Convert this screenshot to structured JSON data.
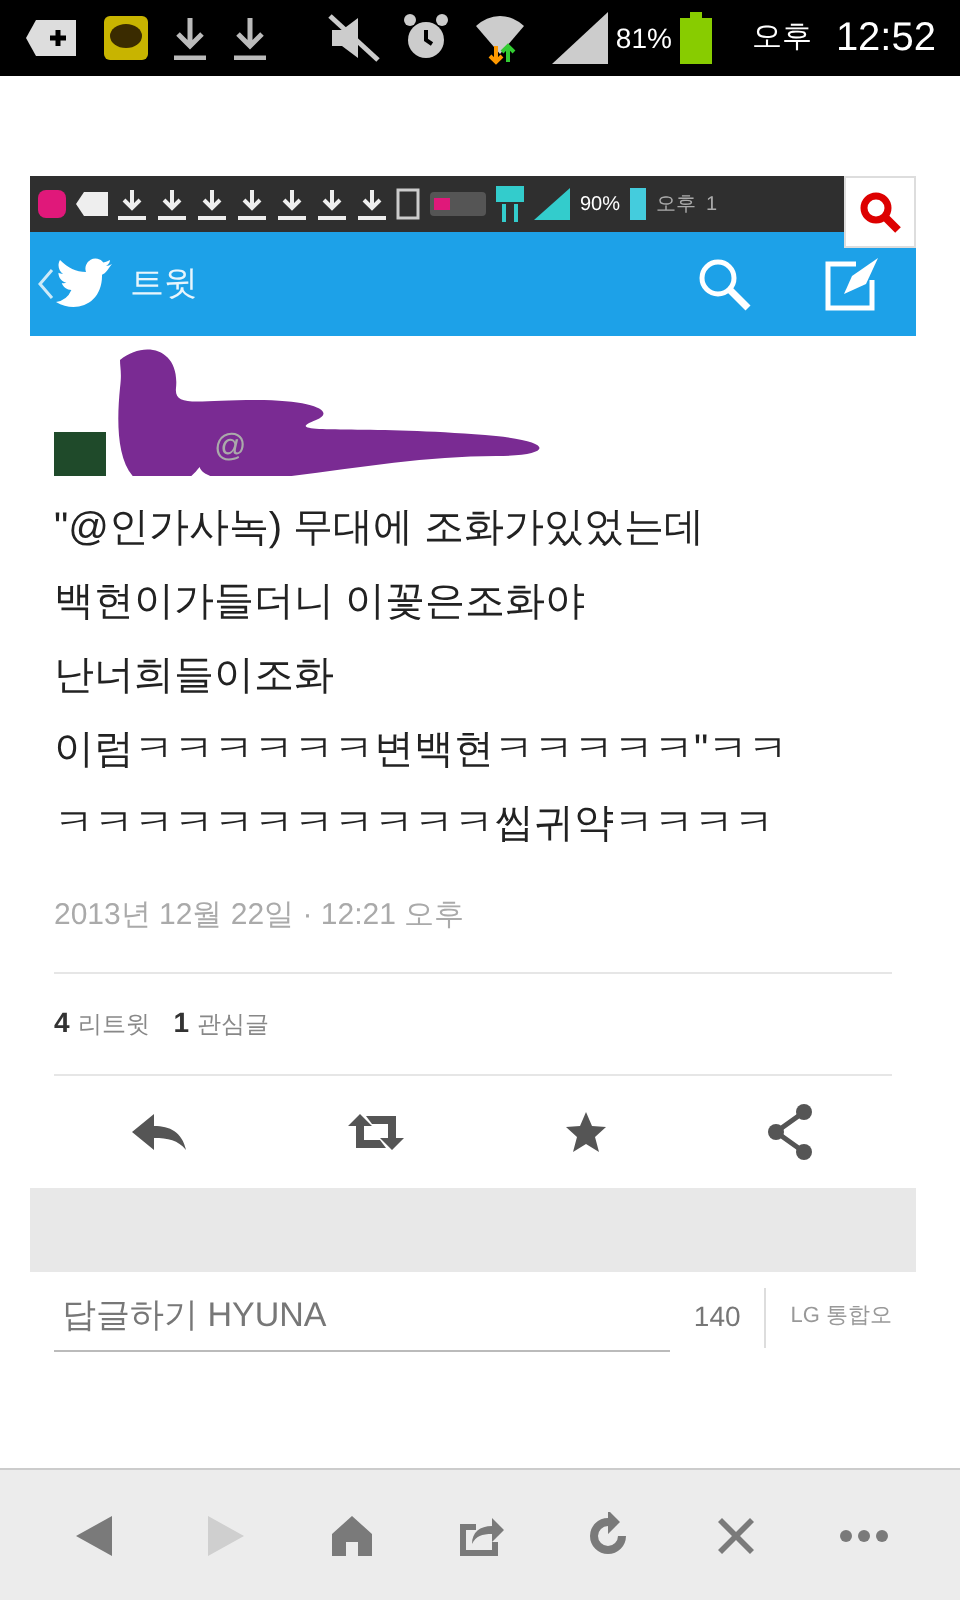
{
  "status_bar": {
    "battery_text": "81%",
    "ampm": "오후",
    "time": "12:52"
  },
  "inner_status_bar": {
    "battery_text": "90%",
    "ampm": "오후",
    "time_partial": "1"
  },
  "app_bar": {
    "title": "트윗"
  },
  "tweet": {
    "handle_partial": "@",
    "lines": [
      "\"@인가사녹) 무대에 조화가있었는데",
      "백현이가들더니 이꽃은조화야",
      "난너희들이조화",
      "이럼ㅋㅋㅋㅋㅋㅋ변백현ㅋㅋㅋㅋㅋ\"ㅋㅋ",
      "ㅋㅋㅋㅋㅋㅋㅋㅋㅋㅋㅋ씹귀약ㅋㅋㅋㅋ"
    ],
    "timestamp": "2013년 12월 22일 · 12:21 오후",
    "stats": [
      {
        "count": "4",
        "label": "리트윗"
      },
      {
        "count": "1",
        "label": "관심글"
      }
    ]
  },
  "reply": {
    "placeholder": "답글하기 HYUNA",
    "counter": "140",
    "keyboard_hint": "LG 통합오"
  },
  "browser_toolbar": [
    {
      "kind": "back",
      "disabled": false
    },
    {
      "kind": "forward",
      "disabled": true
    },
    {
      "kind": "home",
      "disabled": false
    },
    {
      "kind": "share",
      "disabled": false
    },
    {
      "kind": "reload",
      "disabled": false
    },
    {
      "kind": "close",
      "disabled": false
    },
    {
      "kind": "more",
      "disabled": false
    }
  ]
}
